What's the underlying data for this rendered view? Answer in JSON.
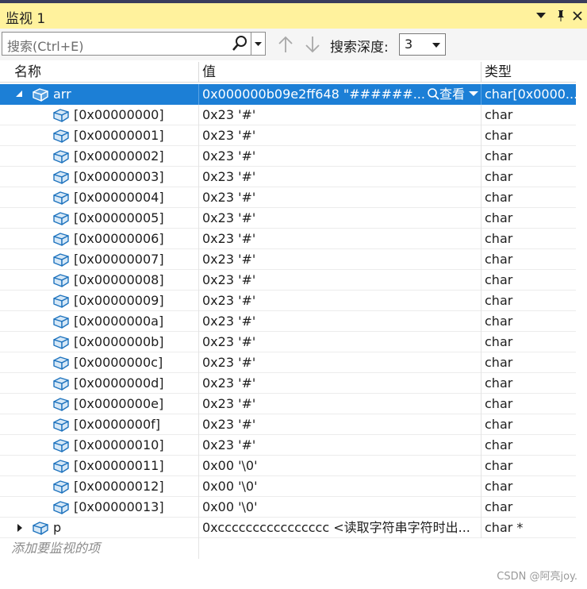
{
  "window": {
    "title": "监视 1"
  },
  "toolbar": {
    "search_placeholder": "搜索(Ctrl+E)",
    "depth_label": "搜索深度:",
    "depth_value": "3"
  },
  "columns": {
    "name": "名称",
    "value": "值",
    "type": "类型"
  },
  "rows": [
    {
      "name": "arr",
      "value": "0x000000b09e2ff648 \"######...",
      "type": "char[0x0000...",
      "level": 0,
      "expander": "open",
      "selected": true,
      "view_label": "查看"
    },
    {
      "name": "[0x00000000]",
      "value": "0x23 '#'",
      "type": "char",
      "level": 1
    },
    {
      "name": "[0x00000001]",
      "value": "0x23 '#'",
      "type": "char",
      "level": 1
    },
    {
      "name": "[0x00000002]",
      "value": "0x23 '#'",
      "type": "char",
      "level": 1
    },
    {
      "name": "[0x00000003]",
      "value": "0x23 '#'",
      "type": "char",
      "level": 1
    },
    {
      "name": "[0x00000004]",
      "value": "0x23 '#'",
      "type": "char",
      "level": 1
    },
    {
      "name": "[0x00000005]",
      "value": "0x23 '#'",
      "type": "char",
      "level": 1
    },
    {
      "name": "[0x00000006]",
      "value": "0x23 '#'",
      "type": "char",
      "level": 1
    },
    {
      "name": "[0x00000007]",
      "value": "0x23 '#'",
      "type": "char",
      "level": 1
    },
    {
      "name": "[0x00000008]",
      "value": "0x23 '#'",
      "type": "char",
      "level": 1
    },
    {
      "name": "[0x00000009]",
      "value": "0x23 '#'",
      "type": "char",
      "level": 1
    },
    {
      "name": "[0x0000000a]",
      "value": "0x23 '#'",
      "type": "char",
      "level": 1
    },
    {
      "name": "[0x0000000b]",
      "value": "0x23 '#'",
      "type": "char",
      "level": 1
    },
    {
      "name": "[0x0000000c]",
      "value": "0x23 '#'",
      "type": "char",
      "level": 1
    },
    {
      "name": "[0x0000000d]",
      "value": "0x23 '#'",
      "type": "char",
      "level": 1
    },
    {
      "name": "[0x0000000e]",
      "value": "0x23 '#'",
      "type": "char",
      "level": 1
    },
    {
      "name": "[0x0000000f]",
      "value": "0x23 '#'",
      "type": "char",
      "level": 1
    },
    {
      "name": "[0x00000010]",
      "value": "0x23 '#'",
      "type": "char",
      "level": 1
    },
    {
      "name": "[0x00000011]",
      "value": "0x00 '\\0'",
      "type": "char",
      "level": 1
    },
    {
      "name": "[0x00000012]",
      "value": "0x00 '\\0'",
      "type": "char",
      "level": 1
    },
    {
      "name": "[0x00000013]",
      "value": "0x00 '\\0'",
      "type": "char",
      "level": 1
    },
    {
      "name": "p",
      "value": "0xcccccccccccccccc <读取字符串字符时出...",
      "type": "char *",
      "level": 0,
      "expander": "closed"
    }
  ],
  "add_item_placeholder": "添加要监视的项",
  "watermark": "CSDN @阿亮joy.",
  "colors": {
    "title_bar": "#fff29d",
    "selection": "#1c7fd6",
    "variable_icon": "#1e73be"
  }
}
